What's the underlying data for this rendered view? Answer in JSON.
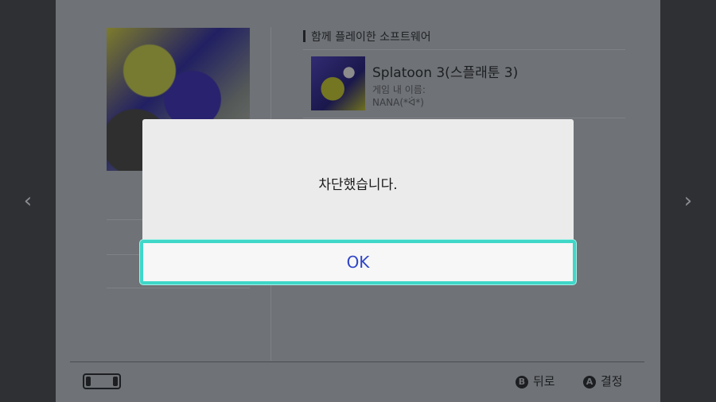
{
  "section": {
    "title": "함께 플레이한 소프트웨어"
  },
  "game": {
    "title": "Splatoon 3(스플래툰 3)",
    "name_label": "게임 내 이름:",
    "name_value": "NANA(*ᐛ*)"
  },
  "dialog": {
    "message": "차단했습니다.",
    "ok_label": "OK"
  },
  "footer": {
    "back_key": "B",
    "back_label": "뒤로",
    "confirm_key": "A",
    "confirm_label": "결정"
  },
  "nav": {
    "prev_icon": "chevron-left-icon",
    "next_icon": "chevron-right-icon"
  },
  "colors": {
    "accent": "#3fd7c8",
    "ok_text": "#2f45c8"
  }
}
